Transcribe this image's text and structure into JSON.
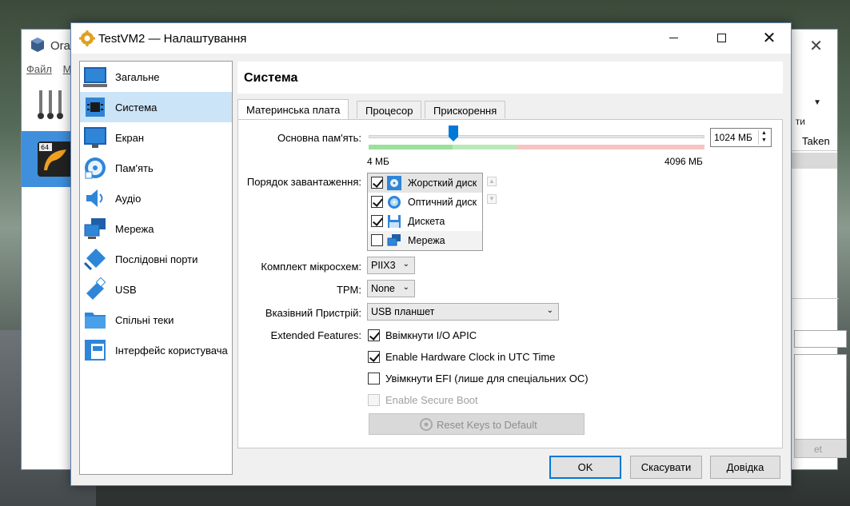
{
  "background_window": {
    "title": "Orac",
    "menu": [
      "Файл",
      "М"
    ],
    "toolbar_text": "ти",
    "table_col": "Taken",
    "button_fragment": "et"
  },
  "dialog": {
    "title": "TestVM2 — Налаштування",
    "nav": [
      {
        "label": "Загальне",
        "icon": "general-icon"
      },
      {
        "label": "Система",
        "icon": "system-icon",
        "selected": true
      },
      {
        "label": "Екран",
        "icon": "display-icon"
      },
      {
        "label": "Пам'ять",
        "icon": "storage-icon"
      },
      {
        "label": "Аудіо",
        "icon": "audio-icon"
      },
      {
        "label": "Мережа",
        "icon": "network-icon"
      },
      {
        "label": "Послідовні порти",
        "icon": "serial-ports-icon"
      },
      {
        "label": "USB",
        "icon": "usb-icon"
      },
      {
        "label": "Спільні теки",
        "icon": "shared-folders-icon"
      },
      {
        "label": "Інтерфейс користувача",
        "icon": "user-interface-icon"
      }
    ],
    "section_title": "Система",
    "tabs": [
      {
        "label": "Материнська плата",
        "active": true
      },
      {
        "label": "Процесор"
      },
      {
        "label": "Прискорення"
      }
    ],
    "motherboard": {
      "base_memory_label": "Основна пам'ять:",
      "memory_value": "1024 МБ",
      "memory_min": "4 МБ",
      "memory_max": "4096 МБ",
      "memory_fraction": 0.25,
      "boot_order_label": "Порядок завантаження:",
      "boot_order": [
        {
          "label": "Жорсткий диск",
          "checked": true,
          "icon": "hard-disk-icon"
        },
        {
          "label": "Оптичний диск",
          "checked": true,
          "icon": "optical-disk-icon"
        },
        {
          "label": "Дискета",
          "checked": true,
          "icon": "floppy-icon"
        },
        {
          "label": "Мережа",
          "checked": false,
          "icon": "network-boot-icon"
        }
      ],
      "chipset_label": "Комплект мікросхем:",
      "chipset_value": "PIIX3",
      "tpm_label": "TPM:",
      "tpm_value": "None",
      "pointing_label": "Вказівний Пристрій:",
      "pointing_value": "USB планшет",
      "extended_label": "Extended Features:",
      "features": [
        {
          "label": "Ввімкнути I/O APIC",
          "checked": true,
          "disabled": false
        },
        {
          "label": "Enable Hardware Clock in UTC Time",
          "checked": true,
          "disabled": false
        },
        {
          "label": "Увімкнути EFI (лише для спеціальних ОС)",
          "checked": false,
          "disabled": false
        },
        {
          "label": "Enable Secure Boot",
          "checked": false,
          "disabled": true
        }
      ],
      "reset_keys_label": "Reset Keys to Default"
    },
    "buttons": {
      "ok": "OK",
      "cancel": "Скасувати",
      "help": "Довідка"
    }
  },
  "colors": {
    "selection": "#cce4f7",
    "accent": "#0078d7",
    "slider_green": "#7ed87e",
    "slider_red": "#f4a0a0"
  }
}
